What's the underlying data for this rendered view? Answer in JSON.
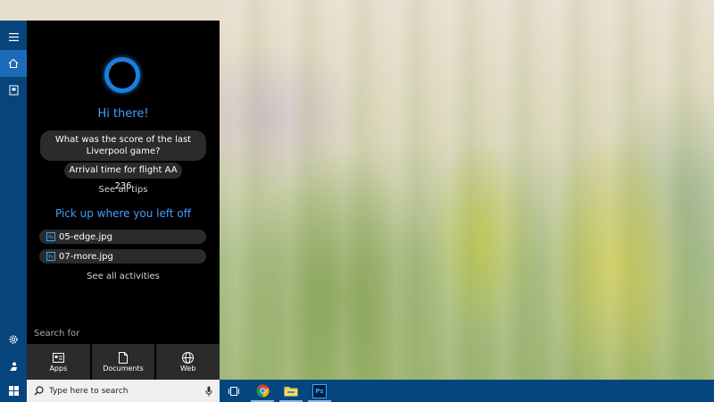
{
  "cortana": {
    "greeting": "Hi there!",
    "tips": [
      "What was the score of the last Liverpool game?",
      "Arrival time for flight AA 236"
    ],
    "see_all_tips": "See all tips",
    "pickup_heading": "Pick up where you left off",
    "recent_files": [
      {
        "name": "05-edge.jpg",
        "icon": "photoshop-icon"
      },
      {
        "name": "07-more.jpg",
        "icon": "photoshop-icon"
      }
    ],
    "see_all_activities": "See all activities",
    "search_for_label": "Search for",
    "search_tiles": [
      {
        "label": "Apps",
        "icon": "apps-icon"
      },
      {
        "label": "Documents",
        "icon": "document-icon"
      },
      {
        "label": "Web",
        "icon": "globe-icon"
      }
    ]
  },
  "rail": {
    "items": [
      "hamburger-menu-icon",
      "home-icon",
      "notebook-icon",
      "settings-icon",
      "feedback-icon"
    ]
  },
  "taskbar": {
    "search_placeholder": "Type here to search",
    "apps": [
      "task-view-icon",
      "chrome-icon",
      "file-explorer-icon",
      "photoshop-icon"
    ],
    "photoshop_label": "Ps",
    "colors": {
      "taskbar": "#06467e",
      "accent": "#3ea2ff"
    }
  }
}
